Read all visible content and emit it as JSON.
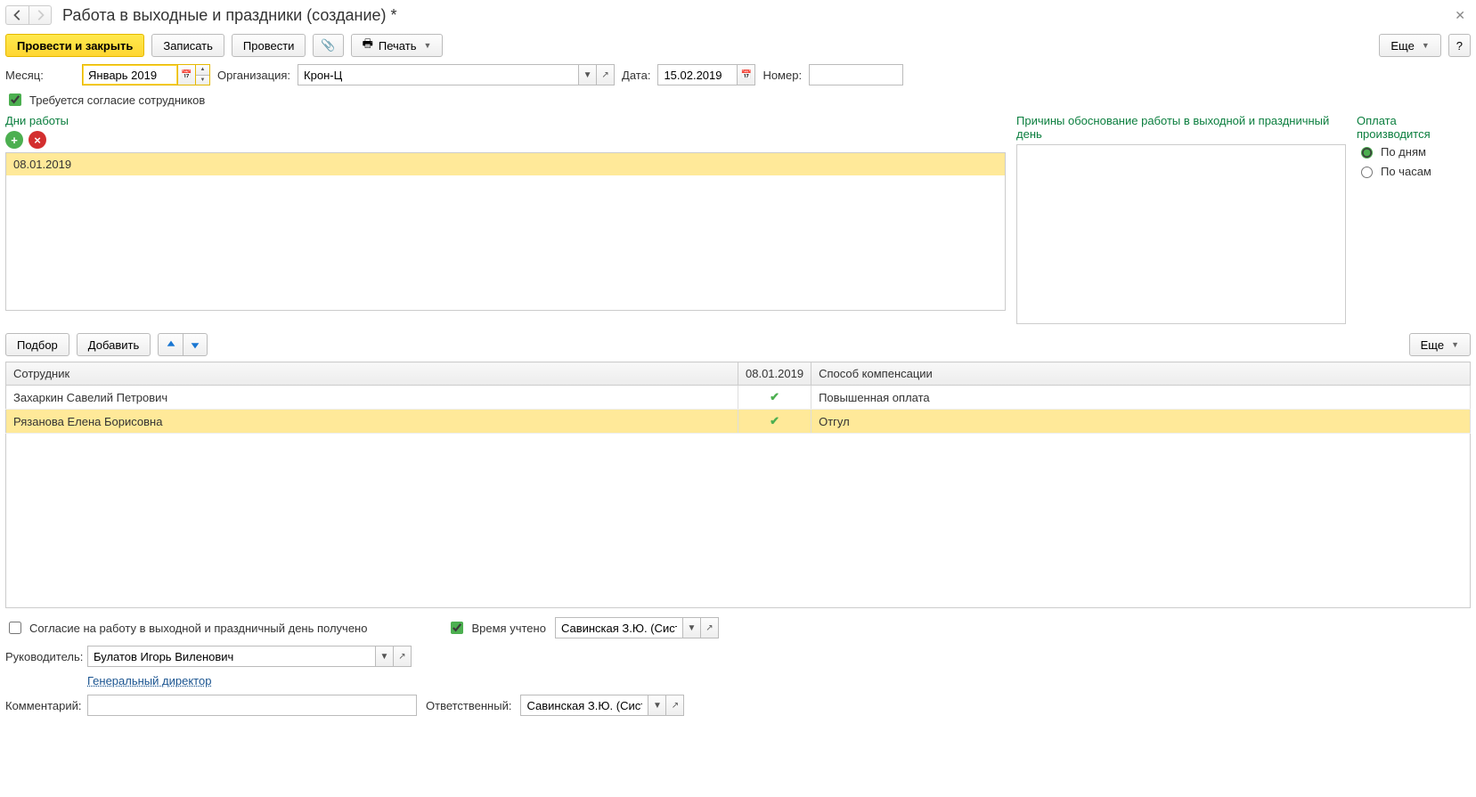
{
  "header": {
    "title": "Работа в выходные и праздники (создание) *"
  },
  "toolbar": {
    "post_close": "Провести и закрыть",
    "save": "Записать",
    "post": "Провести",
    "print": "Печать",
    "more": "Еще",
    "help": "?"
  },
  "fields": {
    "month_label": "Месяц:",
    "month_value": "Январь 2019",
    "org_label": "Организация:",
    "org_value": "Крон-Ц",
    "date_label": "Дата:",
    "date_value": "15.02.2019",
    "number_label": "Номер:",
    "consent_required": "Требуется согласие сотрудников"
  },
  "days": {
    "title": "Дни работы",
    "items": [
      "08.01.2019"
    ]
  },
  "reasons": {
    "title": "Причины обоснование работы в выходной и праздничный день"
  },
  "pay": {
    "title": "Оплата производится",
    "by_days": "По дням",
    "by_hours": "По часам"
  },
  "emp_toolbar": {
    "pick": "Подбор",
    "add": "Добавить",
    "more": "Еще"
  },
  "table": {
    "cols": {
      "employee": "Сотрудник",
      "date": "08.01.2019",
      "comp": "Способ компенсации"
    },
    "rows": [
      {
        "name": "Захаркин Савелий Петрович",
        "checked": true,
        "comp": "Повышенная оплата"
      },
      {
        "name": "Рязанова Елена Борисовна",
        "checked": true,
        "comp": "Отгул"
      }
    ]
  },
  "footer": {
    "consent_received": "Согласие на работу в выходной и праздничный день получено",
    "time_counted": "Время учтено",
    "time_user": "Савинская З.Ю. (Системн",
    "manager_label": "Руководитель:",
    "manager_value": "Булатов Игорь Виленович",
    "manager_position": "Генеральный директор",
    "comment_label": "Комментарий:",
    "responsible_label": "Ответственный:",
    "responsible_value": "Савинская З.Ю. (Системн"
  }
}
